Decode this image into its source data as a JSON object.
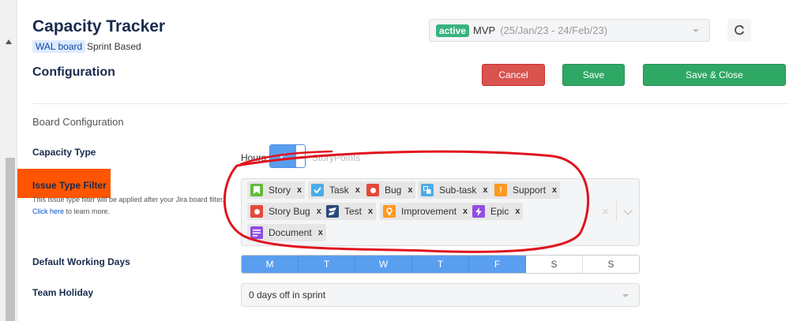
{
  "header": {
    "title": "Capacity Tracker",
    "board_badge": "WAL board",
    "board_type": "Sprint Based",
    "section_title": "Configuration"
  },
  "sprint_select": {
    "status": "active",
    "name": "MVP",
    "dates": "(25/Jan/23 - 24/Feb/23)",
    "status_color": "#36b37e"
  },
  "toolbar": {
    "cancel_label": "Cancel",
    "save_label": "Save",
    "save_close_label": "Save & Close",
    "refresh_icon": "refresh-icon"
  },
  "board_config": {
    "heading": "Board Configuration",
    "capacity_type": {
      "label": "Capacity Type",
      "left_option": "Hours",
      "right_option": "StoryPoints",
      "toggle_mark": "✓",
      "selected": "Hours"
    },
    "issue_type_filter": {
      "label": "Issue Type Filter",
      "note": "This issue type filter will be applied after your Jira board filter.",
      "link_text": "Click here",
      "link_suffix": " to learn more.",
      "tags": [
        {
          "name": "Story",
          "icon": "bookmark-icon",
          "color": "#63ba3c"
        },
        {
          "name": "Task",
          "icon": "checkbox-icon",
          "color": "#4bade8"
        },
        {
          "name": "Bug",
          "icon": "bug-icon",
          "color": "#e5493a"
        },
        {
          "name": "Sub-task",
          "icon": "subtask-icon",
          "color": "#4bade8"
        },
        {
          "name": "Support",
          "icon": "exclamation-icon",
          "color": "#ff991f"
        },
        {
          "name": "Story Bug",
          "icon": "bug-icon",
          "color": "#e5493a"
        },
        {
          "name": "Test",
          "icon": "test-icon",
          "color": "#2a4a7a"
        },
        {
          "name": "Improvement",
          "icon": "lightbulb-icon",
          "color": "#ff991f"
        },
        {
          "name": "Epic",
          "icon": "lightning-icon",
          "color": "#904ee2"
        },
        {
          "name": "Document",
          "icon": "document-icon",
          "color": "#904ee2"
        }
      ],
      "remove_glyph": "x",
      "clear_glyph": "×"
    },
    "working_days": {
      "label": "Default Working Days",
      "days": [
        {
          "letter": "M",
          "on": true
        },
        {
          "letter": "T",
          "on": true
        },
        {
          "letter": "W",
          "on": true
        },
        {
          "letter": "T",
          "on": true
        },
        {
          "letter": "F",
          "on": true
        },
        {
          "letter": "S",
          "on": false
        },
        {
          "letter": "S",
          "on": false
        }
      ]
    },
    "team_holiday": {
      "label": "Team Holiday",
      "value": "0 days off in sprint"
    }
  },
  "annotation": {
    "highlight_color": "#ff5500",
    "scribble_color": "#e0141e"
  }
}
